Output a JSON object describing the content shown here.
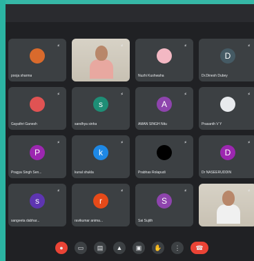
{
  "colors": {
    "background": "#36b7a6",
    "meeting_bg": "#202124",
    "tile_bg": "#3c4043",
    "end_call": "#ea4335"
  },
  "participants": [
    {
      "name": "pooja sharma",
      "avatar_letter": "",
      "avatar_color": "#d96a2c",
      "kind": "photo"
    },
    {
      "name": "",
      "avatar_letter": "",
      "avatar_color": "",
      "kind": "video"
    },
    {
      "name": "Nuzhi Kushwaha",
      "avatar_letter": "",
      "avatar_color": "#f3b8c3",
      "kind": "photo"
    },
    {
      "name": "Dr.Dinesh Dubey",
      "avatar_letter": "D",
      "avatar_color": "#455a64",
      "kind": "letter"
    },
    {
      "name": "Gayathri Ganesh",
      "avatar_letter": "",
      "avatar_color": "#e05353",
      "kind": "photo"
    },
    {
      "name": "sandhya sinha",
      "avatar_letter": "s",
      "avatar_color": "#1e8e76",
      "kind": "letter"
    },
    {
      "name": "AMAN SINGH Nitu",
      "avatar_letter": "A",
      "avatar_color": "#8e44ad",
      "kind": "letter"
    },
    {
      "name": "Prasanth V Y",
      "avatar_letter": "",
      "avatar_color": "#e8eaed",
      "kind": "photo"
    },
    {
      "name": "Pragya Singh Sen...",
      "avatar_letter": "P",
      "avatar_color": "#9c27b0",
      "kind": "letter"
    },
    {
      "name": "kunal shukla",
      "avatar_letter": "k",
      "avatar_color": "#1e88e5",
      "kind": "letter"
    },
    {
      "name": "Prabhas Rolapudi",
      "avatar_letter": "",
      "avatar_color": "#000000",
      "kind": "photo"
    },
    {
      "name": "Dr NASEERUDDIN",
      "avatar_letter": "D",
      "avatar_color": "#9c27b0",
      "kind": "letter"
    },
    {
      "name": "sangeeta dabhar...",
      "avatar_letter": "s",
      "avatar_color": "#5e35b1",
      "kind": "letter"
    },
    {
      "name": "ravikumar anima...",
      "avatar_letter": "r",
      "avatar_color": "#e64a19",
      "kind": "letter"
    },
    {
      "name": "Sai Sujith",
      "avatar_letter": "S",
      "avatar_color": "#8e44ad",
      "kind": "letter"
    },
    {
      "name": "",
      "avatar_letter": "",
      "avatar_color": "",
      "kind": "video"
    }
  ],
  "controls": [
    {
      "name": "mic-off-icon",
      "glyph": "●",
      "style": "red"
    },
    {
      "name": "camera-icon",
      "glyph": "▭",
      "style": ""
    },
    {
      "name": "captions-icon",
      "glyph": "▤",
      "style": ""
    },
    {
      "name": "present-icon",
      "glyph": "▲",
      "style": ""
    },
    {
      "name": "chat-icon",
      "glyph": "▣",
      "style": ""
    },
    {
      "name": "hand-icon",
      "glyph": "✋",
      "style": ""
    },
    {
      "name": "more-icon",
      "glyph": "⋮",
      "style": ""
    },
    {
      "name": "end-call-icon",
      "glyph": "☎",
      "style": "end"
    }
  ]
}
